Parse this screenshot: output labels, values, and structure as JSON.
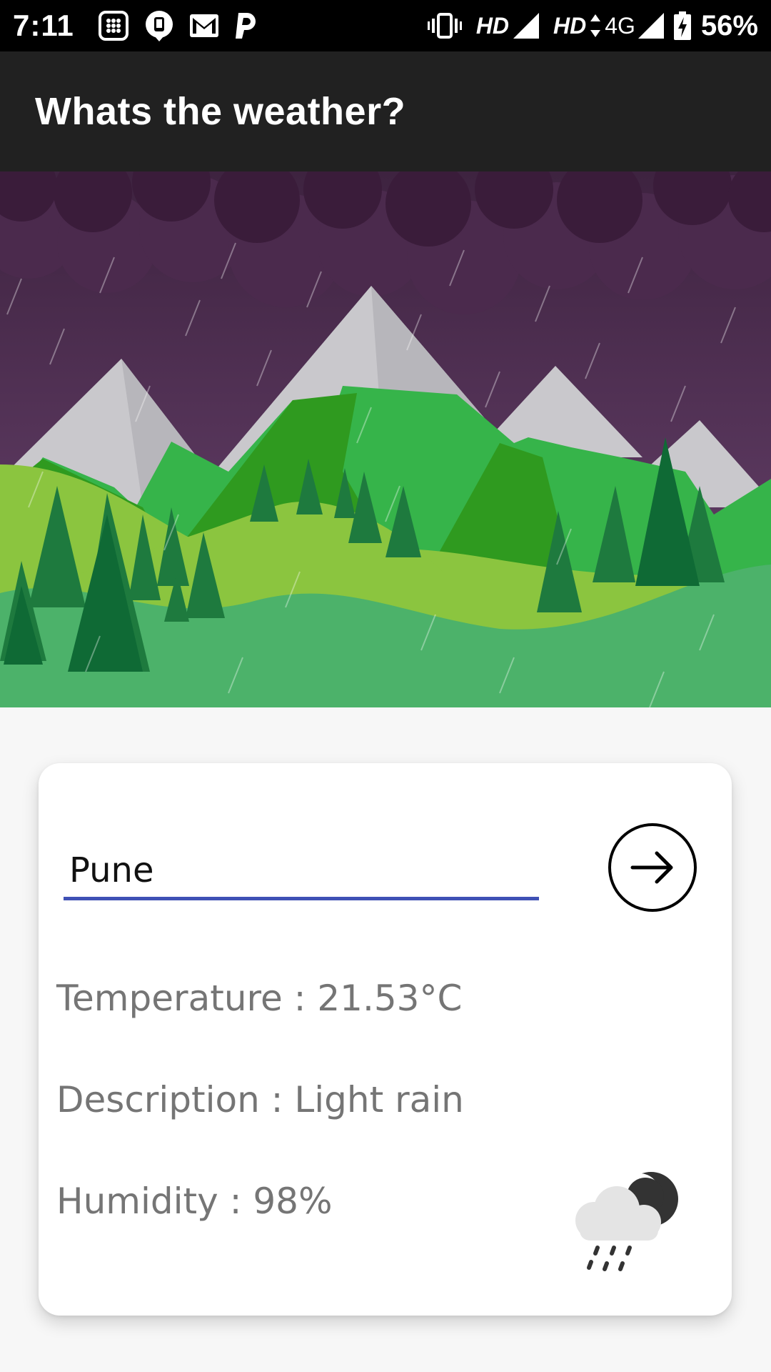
{
  "status_bar": {
    "time": "7:11",
    "network_label_1": "HD",
    "network_label_2": "HD",
    "network_type": "4G",
    "battery_percent": "56%"
  },
  "app_bar": {
    "title": "Whats the weather?"
  },
  "search": {
    "city_value": "Pune",
    "go_icon": "arrow-right-icon"
  },
  "weather": {
    "temperature": "Temperature : 21.53°C",
    "description": "Description : Light rain",
    "humidity": "Humidity : 98%",
    "icon": "rain-night-cloud-icon"
  },
  "colors": {
    "underline": "#3f51b5",
    "sky": "#5e3a63",
    "clouds": "#3b1f3c",
    "grass": "#4cb26a"
  }
}
